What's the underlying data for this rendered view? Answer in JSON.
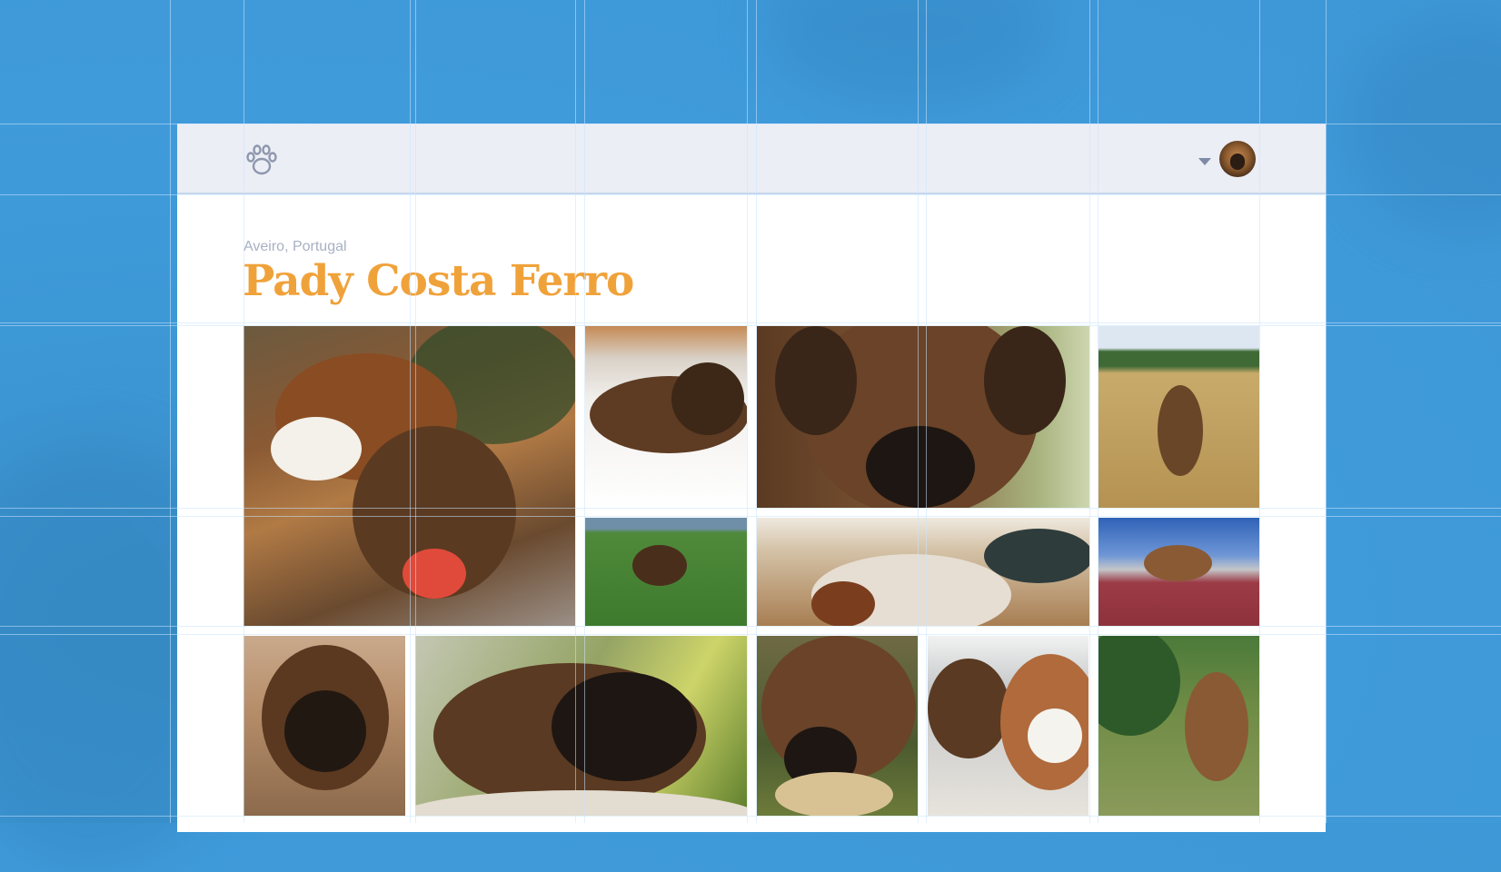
{
  "profile": {
    "location": "Aveiro, Portugal",
    "name": "Pady Costa Ferro"
  },
  "header": {
    "logo_icon": "paw-icon",
    "menu_icon": "caret-down-icon",
    "avatar": "user-avatar"
  },
  "colors": {
    "background": "#409bdb",
    "header_bg": "#eceef5",
    "title": "#f0a23a",
    "location": "#a8b0c3"
  },
  "gallery": {
    "photos": [
      {
        "id": "photo-1",
        "subject": "st-bernard-and-boxer-puppy-christmas"
      },
      {
        "id": "photo-2",
        "subject": "brindle-puppy-on-bed"
      },
      {
        "id": "photo-3",
        "subject": "boxer-face-closeup"
      },
      {
        "id": "photo-4",
        "subject": "puppy-in-dry-grass"
      },
      {
        "id": "photo-5",
        "subject": "puppy-running-on-lawn"
      },
      {
        "id": "photo-6",
        "subject": "st-bernard-sleeping-on-floor"
      },
      {
        "id": "photo-7",
        "subject": "puppy-on-leash-red-court"
      },
      {
        "id": "photo-8",
        "subject": "puppy-lying-portrait"
      },
      {
        "id": "photo-9",
        "subject": "puppy-resting-head-on-grass"
      },
      {
        "id": "photo-10",
        "subject": "puppy-chewing-toy"
      },
      {
        "id": "photo-11",
        "subject": "two-dogs-sleeping"
      },
      {
        "id": "photo-12",
        "subject": "puppy-by-pine-tree"
      }
    ]
  }
}
